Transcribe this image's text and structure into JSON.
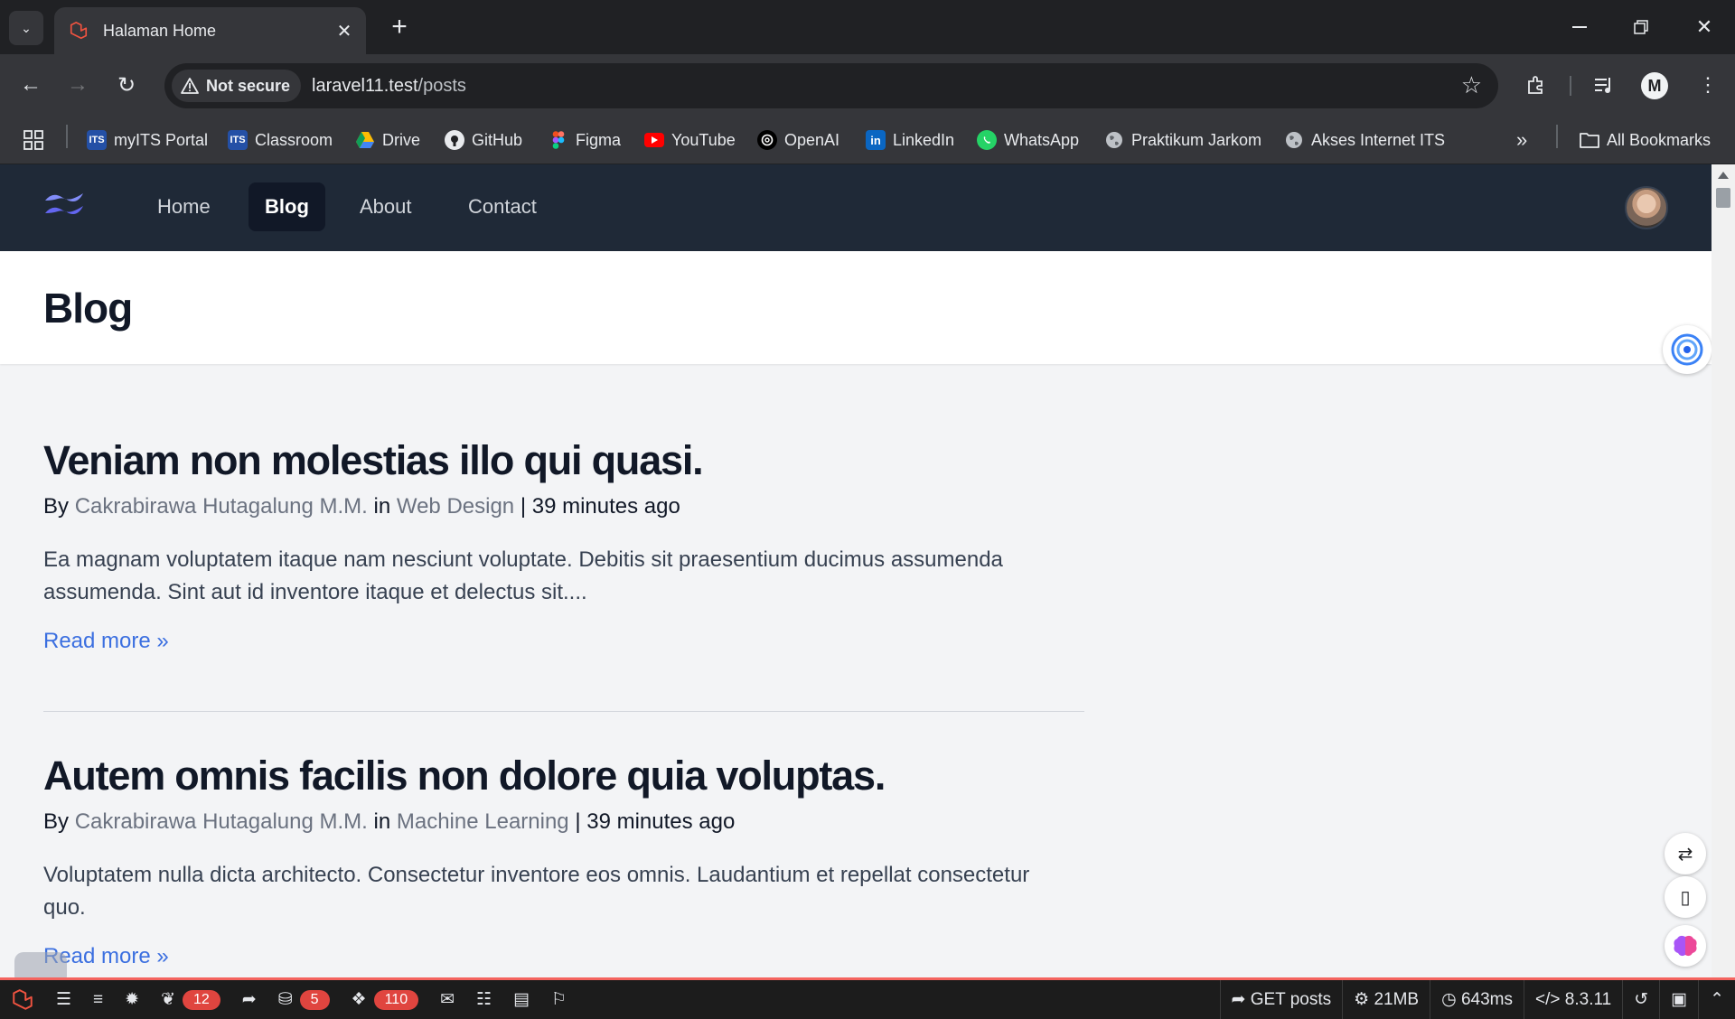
{
  "browser": {
    "tab_title": "Halaman Home",
    "security_label": "Not secure",
    "url_host": "laravel11.test",
    "url_path": "/posts",
    "profile_initial": "M",
    "bookmarks": [
      {
        "label": "myITS Portal",
        "icon": "its-icon"
      },
      {
        "label": "Classroom",
        "icon": "its-icon"
      },
      {
        "label": "Drive",
        "icon": "drive-icon"
      },
      {
        "label": "GitHub",
        "icon": "github-icon"
      },
      {
        "label": "Figma",
        "icon": "figma-icon"
      },
      {
        "label": "YouTube",
        "icon": "youtube-icon"
      },
      {
        "label": "OpenAI",
        "icon": "openai-icon"
      },
      {
        "label": "LinkedIn",
        "icon": "linkedin-icon"
      },
      {
        "label": "WhatsApp",
        "icon": "whatsapp-icon"
      },
      {
        "label": "Praktikum Jarkom",
        "icon": "globe-icon"
      },
      {
        "label": "Akses Internet ITS",
        "icon": "globe-icon"
      }
    ],
    "all_bookmarks_label": "All Bookmarks"
  },
  "site": {
    "nav": [
      {
        "label": "Home",
        "active": false
      },
      {
        "label": "Blog",
        "active": true
      },
      {
        "label": "About",
        "active": false
      },
      {
        "label": "Contact",
        "active": false
      }
    ],
    "page_title": "Blog"
  },
  "posts": [
    {
      "title": "Veniam non molestias illo qui quasi.",
      "by": "By",
      "author": "Cakrabirawa Hutagalung M.M.",
      "in": "in",
      "category": "Web Design",
      "separator": "|",
      "time": "39 minutes ago",
      "excerpt": "Ea magnam voluptatem itaque nam nesciunt voluptate. Debitis sit praesentium ducimus assumenda assumenda. Sint aut id inventore itaque et delectus sit....",
      "read_more": "Read more »"
    },
    {
      "title": "Autem omnis facilis non dolore quia voluptas.",
      "by": "By",
      "author": "Cakrabirawa Hutagalung M.M.",
      "in": "in",
      "category": "Machine Learning",
      "separator": "|",
      "time": "39 minutes ago",
      "excerpt": "Voluptatem nulla dicta architecto. Consectetur inventore eos omnis. Laudantium et repellat consectetur quo.",
      "read_more": "Read more »"
    }
  ],
  "debugbar": {
    "badges": {
      "views": "12",
      "queries": "5",
      "models": "110"
    },
    "route": "GET posts",
    "memory": "21MB",
    "time": "643ms",
    "php": "8.3.11"
  },
  "colors": {
    "nav_bg": "#1f2937",
    "accent_link": "#3b6fe0",
    "debugbar_accent": "#f4645f"
  }
}
